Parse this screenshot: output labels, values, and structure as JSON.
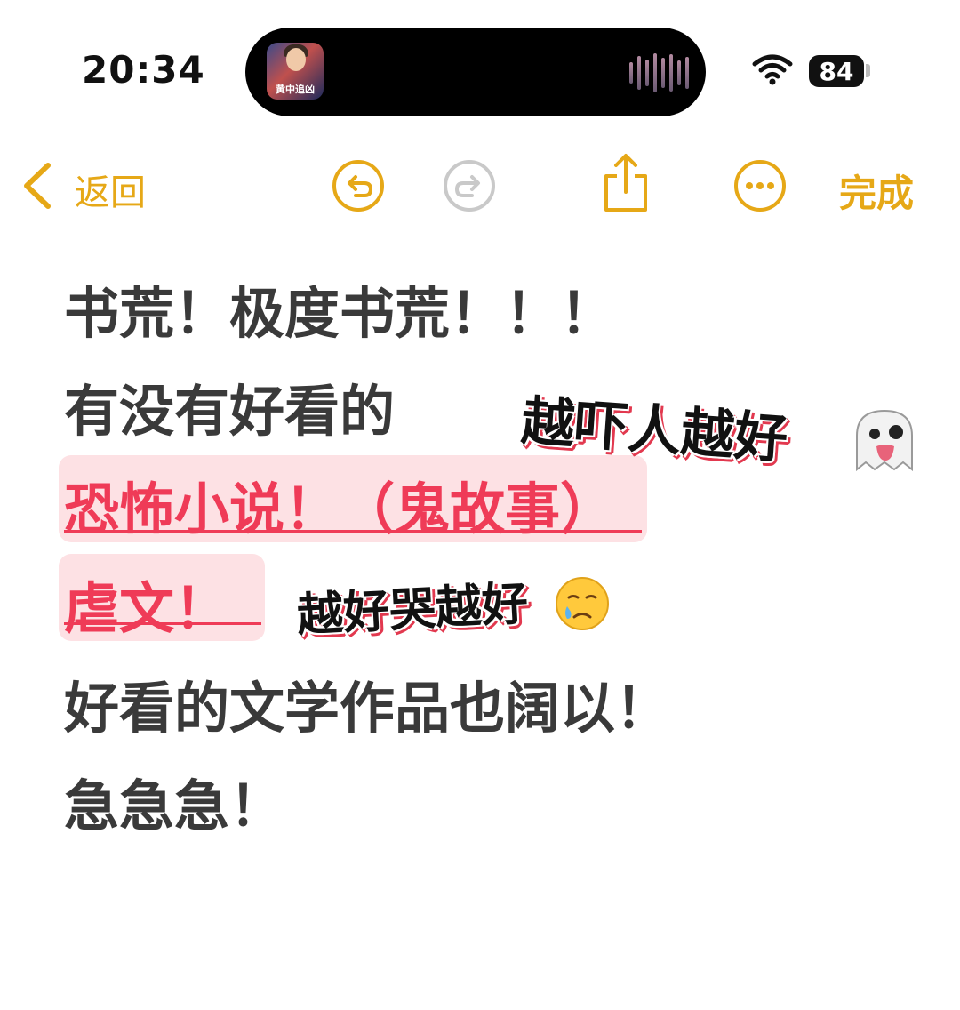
{
  "status_bar": {
    "time": "20:34",
    "battery": "84",
    "now_playing_caption": "黄中追凶",
    "icons": [
      "wifi-icon",
      "battery-icon",
      "audio-waveform-icon"
    ]
  },
  "toolbar": {
    "back_label": "返回",
    "done_label": "完成",
    "accent_color": "#e6a817",
    "icons": [
      "chevron-left-icon",
      "undo-icon",
      "redo-icon",
      "share-icon",
      "more-icon"
    ]
  },
  "note": {
    "lines": [
      "书荒！极度书荒！！！",
      "有没有好看的",
      "恐怖小说！（鬼故事）",
      "虐文！",
      "好看的文学作品也阔以！",
      "急急急！"
    ],
    "highlight_color": "#fde1e4",
    "emphasis_color": "#ef3b57"
  },
  "stickers": {
    "scary": "越吓人越好",
    "cry": "越好哭越好",
    "scary_emoji": "ghost-emoji",
    "cry_emoji": "crying-face-emoji"
  }
}
